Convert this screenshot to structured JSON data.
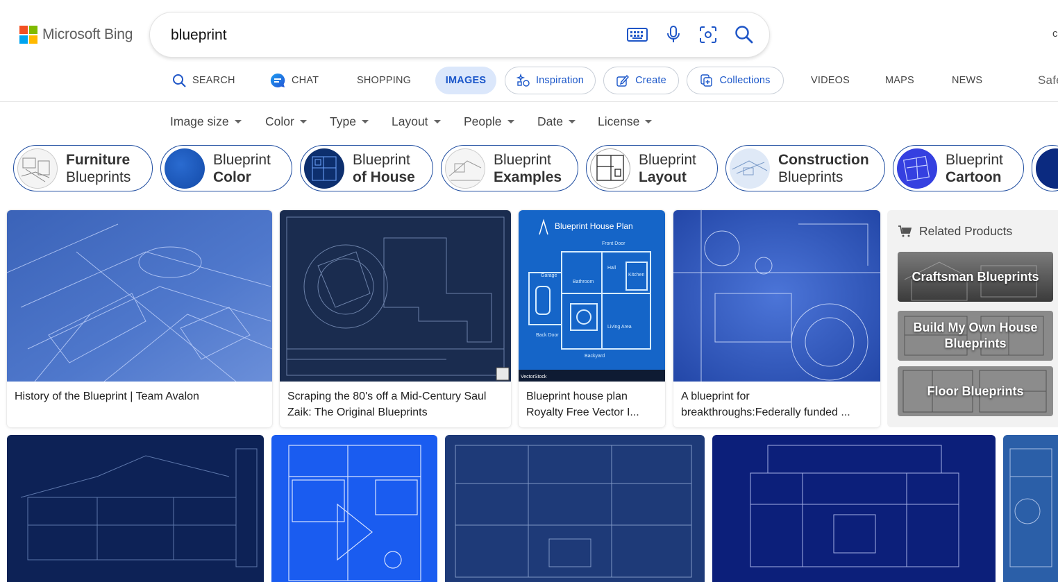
{
  "brand": {
    "name": "Microsoft Bing",
    "colors": [
      "#f25022",
      "#7fba00",
      "#00a4ef",
      "#ffb900"
    ]
  },
  "search": {
    "query": "blueprint",
    "placeholder": ""
  },
  "header": {
    "edge_char": "c"
  },
  "nav": {
    "tabs": [
      {
        "label": "SEARCH",
        "icon": "search-icon"
      },
      {
        "label": "CHAT",
        "icon": "chat-icon"
      },
      {
        "label": "SHOPPING"
      },
      {
        "label": "IMAGES",
        "active": true
      },
      {
        "label": "Inspiration",
        "icon": "inspiration-icon"
      },
      {
        "label": "Create",
        "icon": "create-icon"
      },
      {
        "label": "Collections",
        "icon": "collections-icon"
      },
      {
        "label": "VIDEOS"
      },
      {
        "label": "MAPS"
      },
      {
        "label": "NEWS"
      },
      {
        "label": "Safe"
      }
    ]
  },
  "filters": [
    "Image size",
    "Color",
    "Type",
    "Layout",
    "People",
    "Date",
    "License"
  ],
  "related_searches": [
    {
      "lines": [
        "Furniture",
        "Blueprints"
      ],
      "bold": 0
    },
    {
      "lines": [
        "Blueprint",
        "Color"
      ],
      "bold": 1
    },
    {
      "lines": [
        "Blueprint",
        "of House"
      ],
      "bold": 1
    },
    {
      "lines": [
        "Blueprint",
        "Examples"
      ],
      "bold": 1
    },
    {
      "lines": [
        "Blueprint",
        "Layout"
      ],
      "bold": 1
    },
    {
      "lines": [
        "Construction",
        "Blueprints"
      ],
      "bold": 0
    },
    {
      "lines": [
        "Blueprint",
        "Cartoon"
      ],
      "bold": 1
    }
  ],
  "results": [
    {
      "caption": [
        "History of the Blueprint | Team Avalon"
      ]
    },
    {
      "caption": [
        "Scraping the 80's off a Mid-Century Saul",
        "Zaik: The Original Blueprints"
      ]
    },
    {
      "caption": [
        "Blueprint house plan",
        "Royalty Free Vector I..."
      ],
      "overlay": {
        "title": "Blueprint House Plan",
        "front": "Front Door",
        "garage": "Garage",
        "bath": "Bathroom",
        "hall": "Hall",
        "kitchen": "Kitchen",
        "living": "Living Area",
        "back": "Back Door",
        "yard": "Backyard",
        "wm": "VectorStock"
      }
    },
    {
      "caption": [
        "A blueprint for",
        "breakthroughs:Federally funded ..."
      ]
    }
  ],
  "related_products": {
    "title": "Related Products",
    "items": [
      "Craftsman Blueprints",
      "Build My Own House Blueprints",
      "Floor Blueprints"
    ]
  }
}
